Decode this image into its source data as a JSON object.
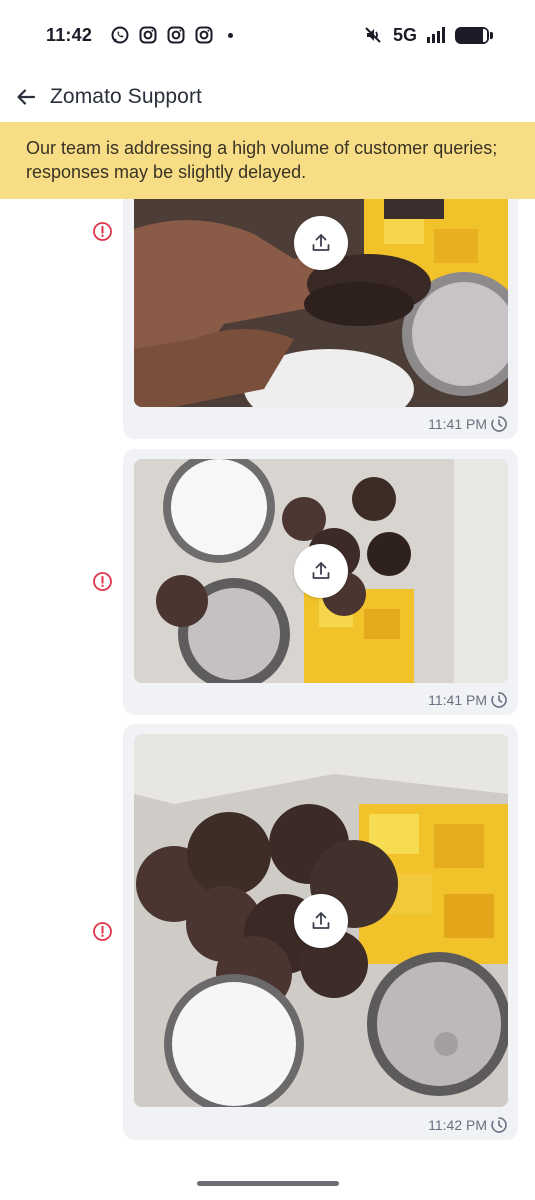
{
  "status_bar": {
    "time": "11:42",
    "network": "5G",
    "notification_icons": [
      "whatsapp-icon",
      "instagram-icon",
      "instagram-icon",
      "instagram-icon"
    ],
    "right_icons": [
      "mute-icon",
      "signal-icon",
      "battery-icon"
    ]
  },
  "header": {
    "title": "Zomato Support",
    "back_icon": "arrow-left-icon"
  },
  "notice": {
    "text": "Our team is addressing a high volume of customer queries; responses may be slightly delayed.",
    "background": "#f6dd86"
  },
  "messages": [
    {
      "type": "image",
      "time": "11:41 PM",
      "status_icon": "clock-icon",
      "error_icon": "error-icon",
      "action_icon": "upload-icon"
    },
    {
      "type": "image",
      "time": "11:41 PM",
      "status_icon": "clock-icon",
      "error_icon": "error-icon",
      "action_icon": "upload-icon"
    },
    {
      "type": "image",
      "time": "11:42 PM",
      "status_icon": "clock-icon",
      "error_icon": "error-icon",
      "action_icon": "upload-icon"
    }
  ],
  "colors": {
    "error": "#e0334a",
    "bubble": "#f1f2f6",
    "meta_text": "#6b7080"
  }
}
